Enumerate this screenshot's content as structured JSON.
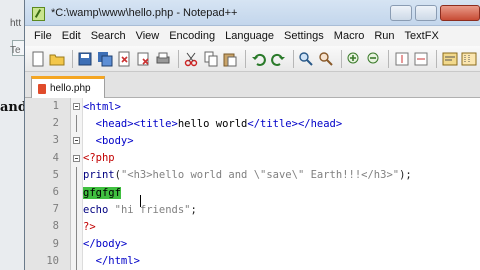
{
  "background_window": {
    "snippet_top": "htt",
    "snippet_mid": "Te",
    "snippet_word": "and"
  },
  "window": {
    "title": "*C:\\wamp\\www\\hello.php - Notepad++"
  },
  "menu": [
    "File",
    "Edit",
    "Search",
    "View",
    "Encoding",
    "Language",
    "Settings",
    "Macro",
    "Run",
    "TextFX"
  ],
  "toolbar": {
    "icons": [
      "new-file-icon",
      "open-file-icon",
      "save-icon",
      "save-all-icon",
      "close-icon",
      "close-all-icon",
      "print-icon",
      "cut-icon",
      "copy-icon",
      "paste-icon",
      "undo-icon",
      "redo-icon",
      "find-icon",
      "replace-icon",
      "zoom-in-icon",
      "zoom-out-icon",
      "sync-v-icon",
      "sync-h-icon",
      "wrap-icon",
      "indent-guide-icon"
    ]
  },
  "tab": {
    "label": "hello.php"
  },
  "editor": {
    "line_numbers": [
      "1",
      "2",
      "3",
      "4",
      "5",
      "6",
      "7",
      "8",
      "9",
      "10"
    ],
    "lines": [
      [
        {
          "t": "<html>",
          "c": "tag"
        }
      ],
      [
        {
          "t": "  <head><title>",
          "c": "tag"
        },
        {
          "t": "hello world",
          "c": "plain"
        },
        {
          "t": "</title></head>",
          "c": "tag"
        }
      ],
      [
        {
          "t": "  <body>",
          "c": "tag"
        }
      ],
      [
        {
          "t": "<?php",
          "c": "php"
        }
      ],
      [
        {
          "t": "print",
          "c": "fn"
        },
        {
          "t": "(",
          "c": "op"
        },
        {
          "t": "\"<h3>hello world and \\\"save\\\" Earth!!!</h3>\"",
          "c": "str"
        },
        {
          "t": ");",
          "c": "op"
        }
      ],
      [
        {
          "t": "gfgfgf",
          "c": "sel"
        }
      ],
      [
        {
          "t": "echo",
          "c": "kw"
        },
        {
          "t": " ",
          "c": "plain"
        },
        {
          "t": "\"hi friends\"",
          "c": "str"
        },
        {
          "t": ";",
          "c": "op"
        }
      ],
      [
        {
          "t": "?>",
          "c": "php"
        }
      ],
      [
        {
          "t": "</body>",
          "c": "tag"
        }
      ],
      [
        {
          "t": "  </html>",
          "c": "tag"
        }
      ]
    ]
  },
  "colors": {
    "tag": "#0000c8",
    "php": "#c20000",
    "selection": "#40c040",
    "tab_accent": "#f5a623"
  }
}
